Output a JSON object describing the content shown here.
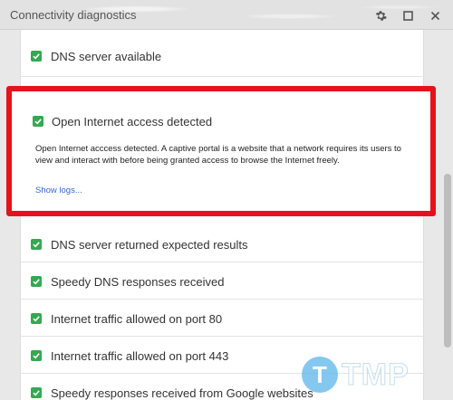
{
  "window": {
    "title": "Connectivity diagnostics"
  },
  "checks": [
    {
      "label": "DNS server available"
    },
    {
      "label": "DNS server returned expected results"
    },
    {
      "label": "Speedy DNS responses received"
    },
    {
      "label": "Internet traffic allowed on port 80"
    },
    {
      "label": "Internet traffic allowed on port 443"
    },
    {
      "label": "Speedy responses received from Google websites"
    }
  ],
  "highlighted": {
    "title": "Open Internet access detected",
    "description": "Open Internet acccess detected. A captive portal is a website that a network requires its users to view and interact with before being granted access to browse the Internet freely.",
    "link": "Show logs..."
  },
  "colors": {
    "check": "#35a852",
    "highlight_border": "#e8111b",
    "link": "#3367d6"
  },
  "watermark": {
    "letter": "T",
    "text": "TMP"
  }
}
